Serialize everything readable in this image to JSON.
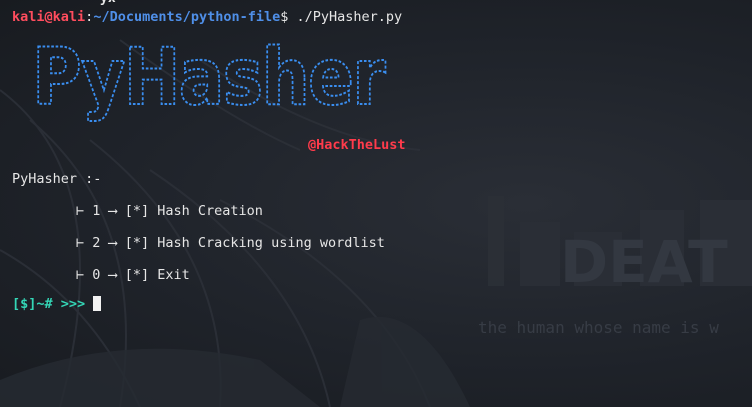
{
  "command_line": {
    "user": "kali",
    "at": "@",
    "host": "kali",
    "separator": ":",
    "path": "~/Documents/python-file",
    "dollar": "$ ",
    "command": "./PyHasher.py"
  },
  "banner": {
    "logo_text": "PyHasher",
    "credit": "@HackTheLust"
  },
  "menu": {
    "title": "PyHasher :-",
    "items": [
      {
        "text": "⊢ 1 ⟶ [*] Hash Creation"
      },
      {
        "text": "⊢ 2 ⟶ [*] Hash Cracking using wordlist"
      },
      {
        "text": "⊢ 0 ⟶ [*] Exit"
      }
    ]
  },
  "input": {
    "prompt": "[$]~# >>>"
  },
  "colors": {
    "background": "#1f232a",
    "prompt_red": "#ff4d5e",
    "path_blue": "#4f8fe8",
    "logo_blue": "#3a8ef0",
    "credit_red": "#ff3b4b",
    "input_teal": "#34d6b6",
    "text": "#e6e6e6"
  }
}
